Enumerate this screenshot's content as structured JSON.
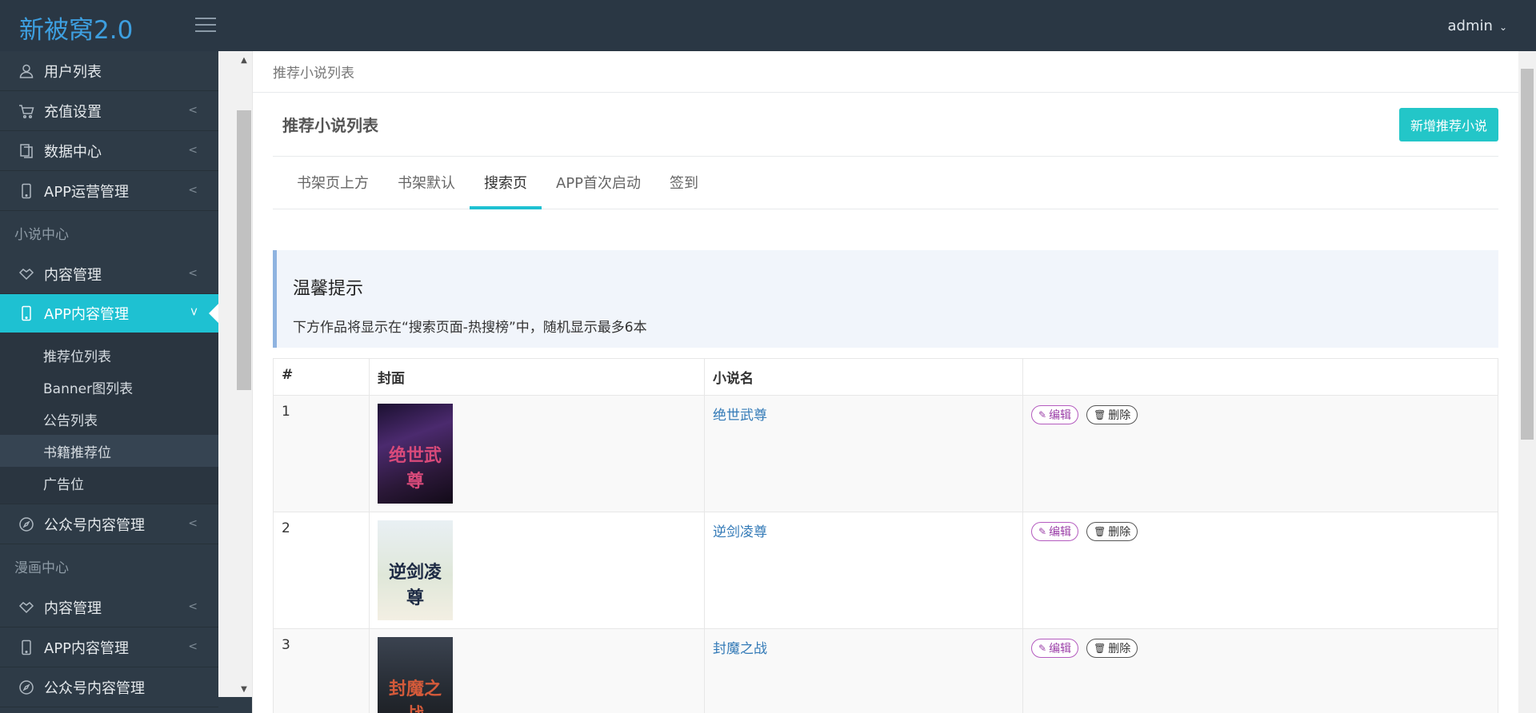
{
  "header": {
    "brand": "新被窝2.0",
    "user": "admin"
  },
  "sidebar": {
    "top_items": [
      {
        "label": "用户列表",
        "icon": "user-icon",
        "has_arrow": false
      },
      {
        "label": "充值设置",
        "icon": "cart-icon",
        "has_arrow": true
      },
      {
        "label": "数据中心",
        "icon": "files-icon",
        "has_arrow": true
      },
      {
        "label": "APP运营管理",
        "icon": "mobile-icon",
        "has_arrow": true
      }
    ],
    "section_novel": "小说中心",
    "novel_content": {
      "label": "内容管理",
      "icon": "handshake-icon"
    },
    "novel_app": {
      "label": "APP内容管理",
      "icon": "mobile-icon"
    },
    "novel_app_sub": [
      "推荐位列表",
      "Banner图列表",
      "公告列表",
      "书籍推荐位",
      "广告位"
    ],
    "official_content": {
      "label": "公众号内容管理",
      "icon": "compass-icon"
    },
    "section_comic": "漫画中心",
    "comic_content": {
      "label": "内容管理",
      "icon": "handshake-icon"
    },
    "comic_app": {
      "label": "APP内容管理",
      "icon": "mobile-icon"
    },
    "comic_official": {
      "label": "公众号内容管理",
      "icon": "compass-icon"
    }
  },
  "breadcrumb": "推荐小说列表",
  "panel": {
    "title": "推荐小说列表",
    "add_button": "新增推荐小说",
    "tabs": [
      "书架页上方",
      "书架默认",
      "搜索页",
      "APP首次启动",
      "签到"
    ],
    "active_tab": 2
  },
  "tip": {
    "title": "温馨提示",
    "text": "下方作品将显示在“搜索页面-热搜榜”中，随机显示最多6本"
  },
  "table": {
    "headers": [
      "#",
      "封面",
      "小说名",
      ""
    ],
    "rows": [
      {
        "num": "1",
        "name": "绝世武尊",
        "cover_text": "绝世武尊"
      },
      {
        "num": "2",
        "name": "逆剑凌尊",
        "cover_text": "逆剑凌尊"
      },
      {
        "num": "3",
        "name": "封魔之战",
        "cover_text": "封魔之战"
      }
    ],
    "edit_label": "编辑",
    "delete_label": "删除"
  },
  "colors": {
    "accent": "#1ec1d2",
    "brand": "#3d9fe0",
    "sidebar_bg": "#2e3b47"
  }
}
